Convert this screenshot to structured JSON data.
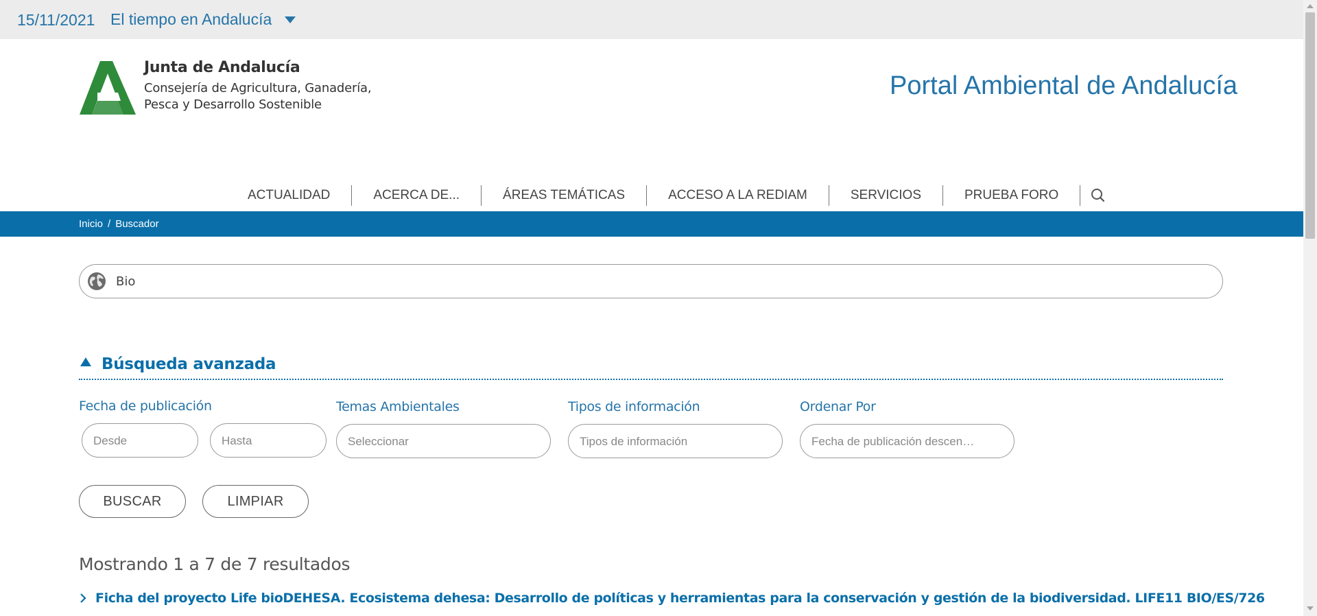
{
  "topbar": {
    "date": "15/11/2021",
    "weather_label": "El tiempo en Andalucía"
  },
  "header": {
    "org_name": "Junta de Andalucía",
    "dept_line1": "Consejería de Agricultura, Ganadería,",
    "dept_line2": "Pesca y Desarrollo Sostenible",
    "portal_title": "Portal Ambiental de Andalucía",
    "logo_color": "#2e8b3a"
  },
  "nav": {
    "items": [
      {
        "label": "ACTUALIDAD"
      },
      {
        "label": "ACERCA DE..."
      },
      {
        "label": "ÁREAS TEMÁTICAS"
      },
      {
        "label": "ACCESO A LA REDIAM"
      },
      {
        "label": "SERVICIOS"
      },
      {
        "label": "PRUEBA FORO"
      }
    ],
    "search_icon": "search-icon"
  },
  "breadcrumb": {
    "home": "Inicio",
    "separator": "/",
    "current": "Buscador"
  },
  "search": {
    "value": "Bio",
    "icon": "globe-icon"
  },
  "advanced": {
    "title": "Búsqueda avanzada",
    "date_label": "Fecha de publicación",
    "from_placeholder": "Desde",
    "to_placeholder": "Hasta",
    "themes_label": "Temas Ambientales",
    "themes_placeholder": "Seleccionar",
    "info_label": "Tipos de información",
    "info_placeholder": "Tipos de información",
    "order_label": "Ordenar Por",
    "order_value": "Fecha de publicación descen…",
    "search_button": "BUSCAR",
    "clear_button": "LIMPIAR"
  },
  "results": {
    "summary": "Mostrando 1 a 7 de 7 resultados",
    "items": [
      {
        "title": "Ficha del proyecto Life bioDEHESA. Ecosistema dehesa: Desarrollo de políticas y herramientas para la conservación y gestión de la biodiversidad. LIFE11 BIO/ES/726"
      }
    ]
  },
  "colors": {
    "brand_blue": "#0a6fa9",
    "link_blue": "#2574a9",
    "topbar_bg": "#ececec"
  }
}
